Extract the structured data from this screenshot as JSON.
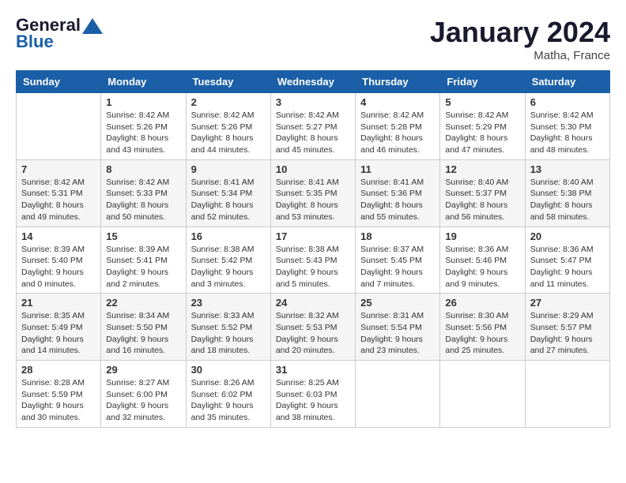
{
  "header": {
    "logo_line1": "General",
    "logo_line2": "Blue",
    "month": "January 2024",
    "location": "Matha, France"
  },
  "columns": [
    "Sunday",
    "Monday",
    "Tuesday",
    "Wednesday",
    "Thursday",
    "Friday",
    "Saturday"
  ],
  "weeks": [
    [
      {
        "day": "",
        "content": ""
      },
      {
        "day": "1",
        "content": "Sunrise: 8:42 AM\nSunset: 5:26 PM\nDaylight: 8 hours\nand 43 minutes."
      },
      {
        "day": "2",
        "content": "Sunrise: 8:42 AM\nSunset: 5:26 PM\nDaylight: 8 hours\nand 44 minutes."
      },
      {
        "day": "3",
        "content": "Sunrise: 8:42 AM\nSunset: 5:27 PM\nDaylight: 8 hours\nand 45 minutes."
      },
      {
        "day": "4",
        "content": "Sunrise: 8:42 AM\nSunset: 5:28 PM\nDaylight: 8 hours\nand 46 minutes."
      },
      {
        "day": "5",
        "content": "Sunrise: 8:42 AM\nSunset: 5:29 PM\nDaylight: 8 hours\nand 47 minutes."
      },
      {
        "day": "6",
        "content": "Sunrise: 8:42 AM\nSunset: 5:30 PM\nDaylight: 8 hours\nand 48 minutes."
      }
    ],
    [
      {
        "day": "7",
        "content": "Sunrise: 8:42 AM\nSunset: 5:31 PM\nDaylight: 8 hours\nand 49 minutes."
      },
      {
        "day": "8",
        "content": "Sunrise: 8:42 AM\nSunset: 5:33 PM\nDaylight: 8 hours\nand 50 minutes."
      },
      {
        "day": "9",
        "content": "Sunrise: 8:41 AM\nSunset: 5:34 PM\nDaylight: 8 hours\nand 52 minutes."
      },
      {
        "day": "10",
        "content": "Sunrise: 8:41 AM\nSunset: 5:35 PM\nDaylight: 8 hours\nand 53 minutes."
      },
      {
        "day": "11",
        "content": "Sunrise: 8:41 AM\nSunset: 5:36 PM\nDaylight: 8 hours\nand 55 minutes."
      },
      {
        "day": "12",
        "content": "Sunrise: 8:40 AM\nSunset: 5:37 PM\nDaylight: 8 hours\nand 56 minutes."
      },
      {
        "day": "13",
        "content": "Sunrise: 8:40 AM\nSunset: 5:38 PM\nDaylight: 8 hours\nand 58 minutes."
      }
    ],
    [
      {
        "day": "14",
        "content": "Sunrise: 8:39 AM\nSunset: 5:40 PM\nDaylight: 9 hours\nand 0 minutes."
      },
      {
        "day": "15",
        "content": "Sunrise: 8:39 AM\nSunset: 5:41 PM\nDaylight: 9 hours\nand 2 minutes."
      },
      {
        "day": "16",
        "content": "Sunrise: 8:38 AM\nSunset: 5:42 PM\nDaylight: 9 hours\nand 3 minutes."
      },
      {
        "day": "17",
        "content": "Sunrise: 8:38 AM\nSunset: 5:43 PM\nDaylight: 9 hours\nand 5 minutes."
      },
      {
        "day": "18",
        "content": "Sunrise: 8:37 AM\nSunset: 5:45 PM\nDaylight: 9 hours\nand 7 minutes."
      },
      {
        "day": "19",
        "content": "Sunrise: 8:36 AM\nSunset: 5:46 PM\nDaylight: 9 hours\nand 9 minutes."
      },
      {
        "day": "20",
        "content": "Sunrise: 8:36 AM\nSunset: 5:47 PM\nDaylight: 9 hours\nand 11 minutes."
      }
    ],
    [
      {
        "day": "21",
        "content": "Sunrise: 8:35 AM\nSunset: 5:49 PM\nDaylight: 9 hours\nand 14 minutes."
      },
      {
        "day": "22",
        "content": "Sunrise: 8:34 AM\nSunset: 5:50 PM\nDaylight: 9 hours\nand 16 minutes."
      },
      {
        "day": "23",
        "content": "Sunrise: 8:33 AM\nSunset: 5:52 PM\nDaylight: 9 hours\nand 18 minutes."
      },
      {
        "day": "24",
        "content": "Sunrise: 8:32 AM\nSunset: 5:53 PM\nDaylight: 9 hours\nand 20 minutes."
      },
      {
        "day": "25",
        "content": "Sunrise: 8:31 AM\nSunset: 5:54 PM\nDaylight: 9 hours\nand 23 minutes."
      },
      {
        "day": "26",
        "content": "Sunrise: 8:30 AM\nSunset: 5:56 PM\nDaylight: 9 hours\nand 25 minutes."
      },
      {
        "day": "27",
        "content": "Sunrise: 8:29 AM\nSunset: 5:57 PM\nDaylight: 9 hours\nand 27 minutes."
      }
    ],
    [
      {
        "day": "28",
        "content": "Sunrise: 8:28 AM\nSunset: 5:59 PM\nDaylight: 9 hours\nand 30 minutes."
      },
      {
        "day": "29",
        "content": "Sunrise: 8:27 AM\nSunset: 6:00 PM\nDaylight: 9 hours\nand 32 minutes."
      },
      {
        "day": "30",
        "content": "Sunrise: 8:26 AM\nSunset: 6:02 PM\nDaylight: 9 hours\nand 35 minutes."
      },
      {
        "day": "31",
        "content": "Sunrise: 8:25 AM\nSunset: 6:03 PM\nDaylight: 9 hours\nand 38 minutes."
      },
      {
        "day": "",
        "content": ""
      },
      {
        "day": "",
        "content": ""
      },
      {
        "day": "",
        "content": ""
      }
    ]
  ]
}
